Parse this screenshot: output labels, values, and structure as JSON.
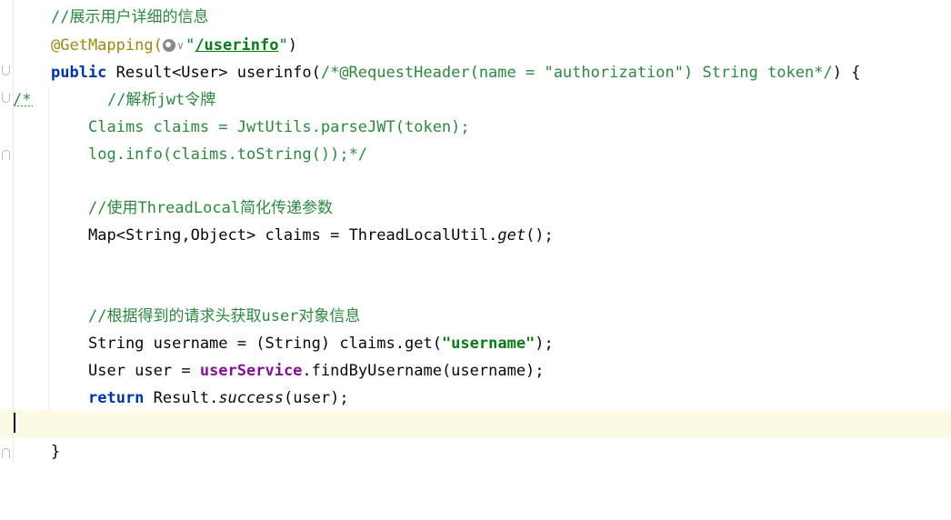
{
  "editor": {
    "gutter_comment_start": "/*",
    "lines": {
      "l1_comment": "//展示用户详细的信息",
      "l2_annotation": "@GetMapping(",
      "l2_path": "/userinfo",
      "l2_close": ")",
      "l3_public": "public",
      "l3_sig": " Result<User> userinfo(",
      "l3_comment": "/*@RequestHeader(name = \"authorization\") String token*/",
      "l3_end": ") {",
      "l4_comment": "//解析jwt令牌",
      "l5_code": "Claims claims = JwtUtils.parseJWT(token);",
      "l6_code": "log.info(claims.toString());*/",
      "l8_comment": "//使用ThreadLocal简化传递参数",
      "l9_code": "Map<String,Object> claims = ThreadLocalUtil.",
      "l9_get": "get",
      "l9_end": "();",
      "l12_comment": "//根据得到的请求头获取user对象信息",
      "l13_code": "String username = (String) claims.get(",
      "l13_str": "\"username\"",
      "l13_end": ");",
      "l14_start": "User user = ",
      "l14_field": "userService",
      "l14_end": ".findByUsername(username);",
      "l15_return": "return",
      "l15_mid": " Result.",
      "l15_success": "success",
      "l15_end": "(user);",
      "l17_close": "}"
    },
    "icons": {
      "url_icon": "globe-icon",
      "url_dropdown": "chevron-down-icon"
    }
  }
}
